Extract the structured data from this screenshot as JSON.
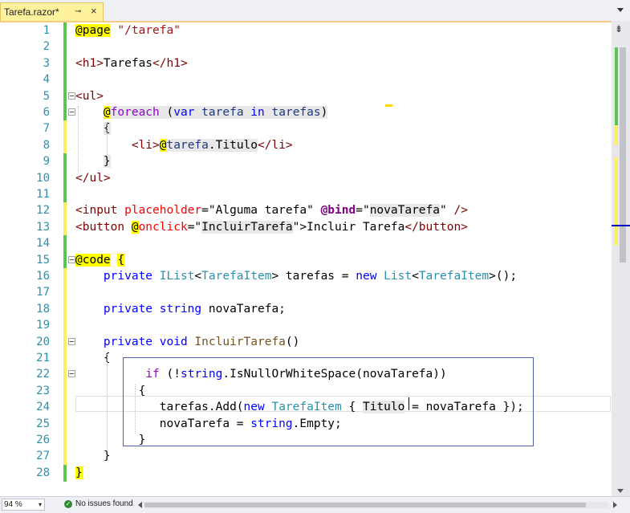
{
  "tab": {
    "title": "Tarefa.razor*",
    "pin": "⊸",
    "close": "×"
  },
  "lines": [
    {
      "n": "1",
      "parts": [
        [
          "@page",
          "t-razor"
        ],
        [
          " ",
          ""
        ],
        [
          "\"/tarefa\"",
          "t-str"
        ]
      ]
    },
    {
      "n": "2",
      "parts": []
    },
    {
      "n": "3",
      "parts": [
        [
          "<h1>",
          "t-tag"
        ],
        [
          "Tarefas",
          ""
        ],
        [
          "</h1>",
          "t-tag"
        ]
      ]
    },
    {
      "n": "4",
      "parts": []
    },
    {
      "n": "5",
      "parts": [
        [
          "<ul>",
          "t-tag"
        ]
      ]
    },
    {
      "n": "6",
      "parts": [
        [
          "    ",
          ""
        ],
        [
          "@",
          "t-razor"
        ],
        [
          "foreach",
          "t-ctrl hl"
        ],
        [
          " (",
          "hl"
        ],
        [
          "var",
          "t-kw hl"
        ],
        [
          " ",
          "hl"
        ],
        [
          "tarefa",
          "t-var hl"
        ],
        [
          " ",
          "hl"
        ],
        [
          "in",
          "t-kw hl"
        ],
        [
          " ",
          "hl"
        ],
        [
          "tarefas",
          "t-var hl"
        ],
        [
          ")",
          "hl"
        ]
      ]
    },
    {
      "n": "7",
      "parts": [
        [
          "    ",
          ""
        ],
        [
          "{",
          "hl"
        ]
      ]
    },
    {
      "n": "8",
      "parts": [
        [
          "        ",
          ""
        ],
        [
          "<li>",
          "t-tag"
        ],
        [
          "@",
          "t-razor"
        ],
        [
          "tarefa",
          "t-var hl"
        ],
        [
          ".",
          "hl"
        ],
        [
          "Titulo",
          "hl"
        ],
        [
          "</li>",
          "t-tag"
        ]
      ]
    },
    {
      "n": "9",
      "parts": [
        [
          "    ",
          ""
        ],
        [
          "}",
          "hl"
        ]
      ]
    },
    {
      "n": "10",
      "parts": [
        [
          "</ul>",
          "t-tag"
        ]
      ]
    },
    {
      "n": "11",
      "parts": []
    },
    {
      "n": "12",
      "parts": [
        [
          "<input",
          "t-tag"
        ],
        [
          " ",
          ""
        ],
        [
          "placeholder",
          "t-attr"
        ],
        [
          "=\"Alguma tarefa\"",
          ""
        ],
        [
          " ",
          ""
        ],
        [
          "@bind",
          "t-dir"
        ],
        [
          "=\"",
          ""
        ],
        [
          "novaTarefa",
          "hl"
        ],
        [
          "\"",
          ""
        ],
        [
          " />",
          "t-tag"
        ]
      ]
    },
    {
      "n": "13",
      "parts": [
        [
          "<button",
          "t-tag"
        ],
        [
          " ",
          ""
        ],
        [
          "@",
          "t-razor"
        ],
        [
          "onclick",
          "t-attr"
        ],
        [
          "=\"",
          ""
        ],
        [
          "IncluirTarefa",
          "hl"
        ],
        [
          "\">Incluir Tarefa",
          ""
        ],
        [
          "</button>",
          "t-tag"
        ]
      ]
    },
    {
      "n": "14",
      "parts": []
    },
    {
      "n": "15",
      "parts": [
        [
          "@code",
          "t-razor"
        ],
        [
          " ",
          ""
        ],
        [
          "{",
          "t-razor"
        ]
      ]
    },
    {
      "n": "16",
      "parts": [
        [
          "    ",
          ""
        ],
        [
          "private",
          "t-kw"
        ],
        [
          " ",
          ""
        ],
        [
          "IList",
          "t-type"
        ],
        [
          "<",
          ""
        ],
        [
          "TarefaItem",
          "t-type"
        ],
        [
          "> tarefas = ",
          ""
        ],
        [
          "new",
          "t-kw"
        ],
        [
          " ",
          ""
        ],
        [
          "List",
          "t-type"
        ],
        [
          "<",
          ""
        ],
        [
          "TarefaItem",
          "t-type"
        ],
        [
          ">();",
          ""
        ]
      ]
    },
    {
      "n": "17",
      "parts": []
    },
    {
      "n": "18",
      "parts": [
        [
          "    ",
          ""
        ],
        [
          "private",
          "t-kw"
        ],
        [
          " ",
          ""
        ],
        [
          "string",
          "t-kw"
        ],
        [
          " novaTarefa;",
          ""
        ]
      ]
    },
    {
      "n": "19",
      "parts": []
    },
    {
      "n": "20",
      "parts": [
        [
          "    ",
          ""
        ],
        [
          "private",
          "t-kw"
        ],
        [
          " ",
          ""
        ],
        [
          "void",
          "t-kw"
        ],
        [
          " ",
          ""
        ],
        [
          "IncluirTarefa",
          "t-method"
        ],
        [
          "()",
          ""
        ]
      ]
    },
    {
      "n": "21",
      "parts": [
        [
          "    ",
          ""
        ],
        [
          "{",
          ""
        ]
      ]
    },
    {
      "n": "22",
      "parts": [
        [
          "          ",
          ""
        ],
        [
          "if",
          "t-ctrl"
        ],
        [
          " (!",
          ""
        ],
        [
          "string",
          "t-kw"
        ],
        [
          ".IsNullOrWhiteSpace(novaTarefa))",
          ""
        ]
      ]
    },
    {
      "n": "23",
      "parts": [
        [
          "         ",
          ""
        ],
        [
          "{",
          ""
        ]
      ]
    },
    {
      "n": "24",
      "parts": [
        [
          "            ",
          ""
        ],
        [
          "tarefas.Add(",
          ""
        ],
        [
          "new",
          "t-kw"
        ],
        [
          " ",
          ""
        ],
        [
          "TarefaItem",
          "t-type"
        ],
        [
          " { ",
          ""
        ],
        [
          "Titulo",
          "hl"
        ],
        [
          " = novaTarefa });",
          ""
        ]
      ]
    },
    {
      "n": "25",
      "parts": [
        [
          "            ",
          ""
        ],
        [
          "novaTarefa = ",
          ""
        ],
        [
          "string",
          "t-kw"
        ],
        [
          ".Empty;",
          ""
        ]
      ]
    },
    {
      "n": "26",
      "parts": [
        [
          "         ",
          ""
        ],
        [
          "}",
          ""
        ]
      ]
    },
    {
      "n": "27",
      "parts": [
        [
          "    ",
          ""
        ],
        [
          "}",
          ""
        ]
      ]
    },
    {
      "n": "28",
      "parts": [
        [
          "}",
          "t-razor"
        ]
      ]
    }
  ],
  "status": {
    "zoom": "94 %",
    "zoom_arrow": "▾",
    "issues": "No issues found",
    "check": "✓"
  },
  "scrollbar": {
    "split": "⇟"
  },
  "colors": {
    "line_number": "#2b91af",
    "tab_bg": "#fff29d",
    "saved_change": "#57c752",
    "unsaved_change": "#ffee62",
    "box_border": "#4e5fa8"
  }
}
